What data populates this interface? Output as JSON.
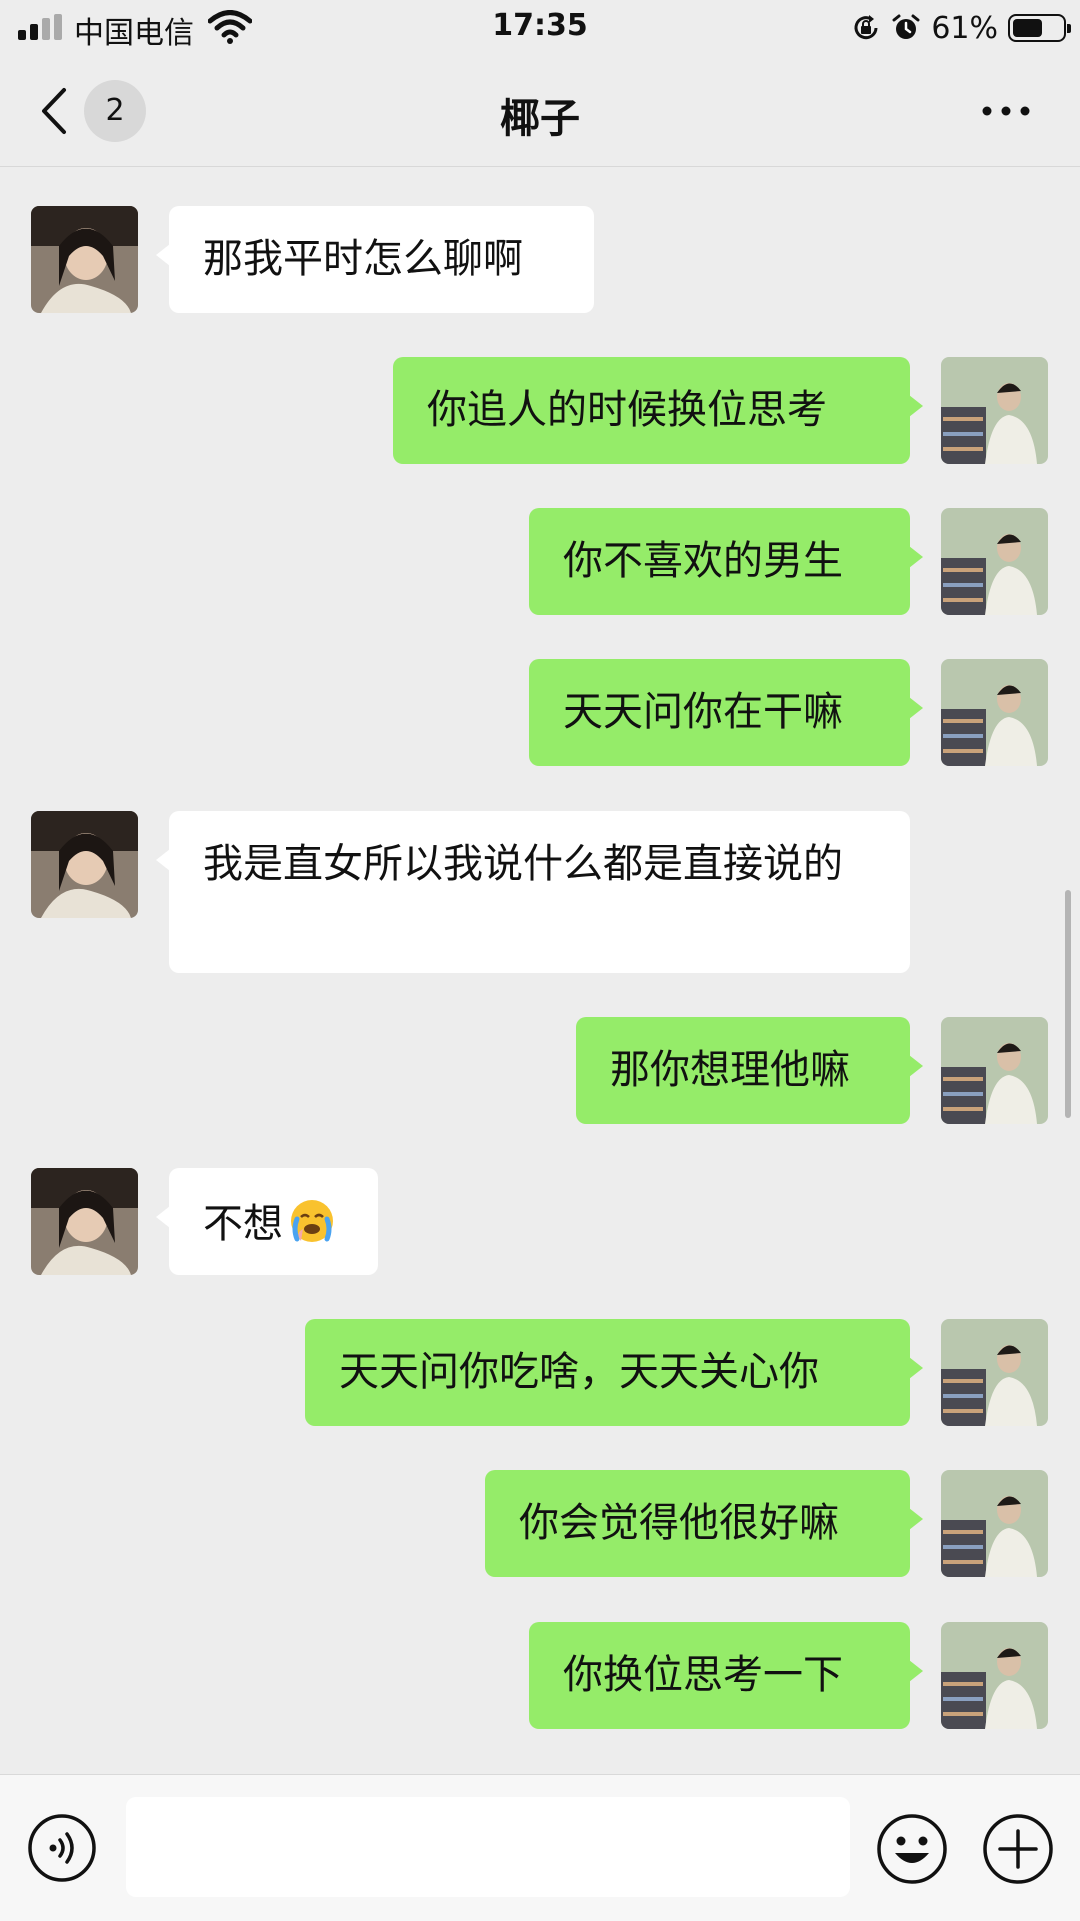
{
  "status_bar": {
    "carrier": "中国电信",
    "time": "17:35",
    "battery_percent": "61%",
    "battery_level": 0.61,
    "icons": [
      "signal-icon",
      "wifi-icon",
      "orientation-lock-icon",
      "alarm-icon",
      "battery-icon"
    ]
  },
  "nav": {
    "back_icon": "chevron-left-icon",
    "unread_count": "2",
    "title": "椰子",
    "more_icon": "more-dots-icon"
  },
  "messages": [
    {
      "side": "in",
      "text": "那我平时怎么聊啊"
    },
    {
      "side": "out",
      "text": "你追人的时候换位思考"
    },
    {
      "side": "out",
      "text": "你不喜欢的男生"
    },
    {
      "side": "out",
      "text": "天天问你在干嘛"
    },
    {
      "side": "in",
      "text": "我是直女所以我说什么都是直接说的"
    },
    {
      "side": "out",
      "text": "那你想理他嘛"
    },
    {
      "side": "in",
      "text": "不想",
      "emoji": "crying-face-emoji"
    },
    {
      "side": "out",
      "text": "天天问你吃啥，天天关心你"
    },
    {
      "side": "out",
      "text": "你会觉得他很好嘛"
    },
    {
      "side": "out",
      "text": "你换位思考一下"
    }
  ],
  "input_bar": {
    "text_value": "",
    "icons": [
      "voice-icon",
      "emoji-icon",
      "plus-icon"
    ]
  },
  "colors": {
    "background": "#ededed",
    "incoming_bubble": "#ffffff",
    "outgoing_bubble": "#95ec69",
    "input_bar": "#f7f7f7"
  }
}
